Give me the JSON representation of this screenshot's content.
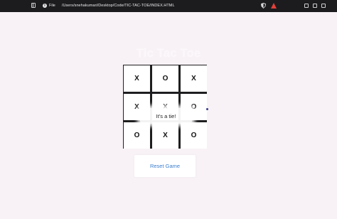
{
  "browser": {
    "file_label": "File",
    "url": "/Users/snehakumari/Desktop/Code/TIC-TAC-TOE/INDEX.HTML"
  },
  "page": {
    "title": "Tic Tac Toe",
    "board": [
      "X",
      "O",
      "X",
      "X",
      "X",
      "O",
      "O",
      "X",
      "O"
    ],
    "status": "It's a tie!",
    "reset_label": "Reset Game"
  }
}
